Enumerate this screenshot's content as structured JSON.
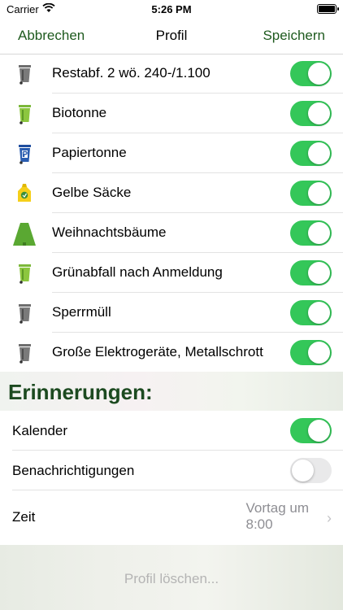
{
  "status": {
    "carrier": "Carrier",
    "time": "5:26 PM"
  },
  "nav": {
    "cancel": "Abbrechen",
    "title": "Profil",
    "save": "Speichern"
  },
  "waste_types": [
    {
      "label": "Restabf. 2 wö. 240-/1.100",
      "icon": "gray-bin-icon",
      "enabled": true
    },
    {
      "label": "Biotonne",
      "icon": "green-bin-icon",
      "enabled": true
    },
    {
      "label": "Papiertonne",
      "icon": "paper-bin-icon",
      "enabled": true
    },
    {
      "label": "Gelbe Säcke",
      "icon": "yellow-bag-icon",
      "enabled": true
    },
    {
      "label": "Weihnachtsbäume",
      "icon": "christmas-tree-icon",
      "enabled": true
    },
    {
      "label": "Grünabfall nach Anmeldung",
      "icon": "green-bin-icon",
      "enabled": true
    },
    {
      "label": "Sperrmüll",
      "icon": "gray-bin-icon",
      "enabled": true
    },
    {
      "label": "Große Elektrogeräte, Metallschrott",
      "icon": "gray-bin-icon",
      "enabled": true
    }
  ],
  "reminders": {
    "header": "Erinnerungen:",
    "calendar": {
      "label": "Kalender",
      "enabled": true
    },
    "notifications": {
      "label": "Benachrichtigungen",
      "enabled": false
    },
    "time": {
      "label": "Zeit",
      "value_line1": "Vortag um",
      "value_line2": "8:00"
    }
  },
  "footer": {
    "delete_label": "Profil löschen..."
  },
  "colors": {
    "accent": "#1e5a1e",
    "toggle_on": "#34c759",
    "header_text": "#1c4a20"
  }
}
